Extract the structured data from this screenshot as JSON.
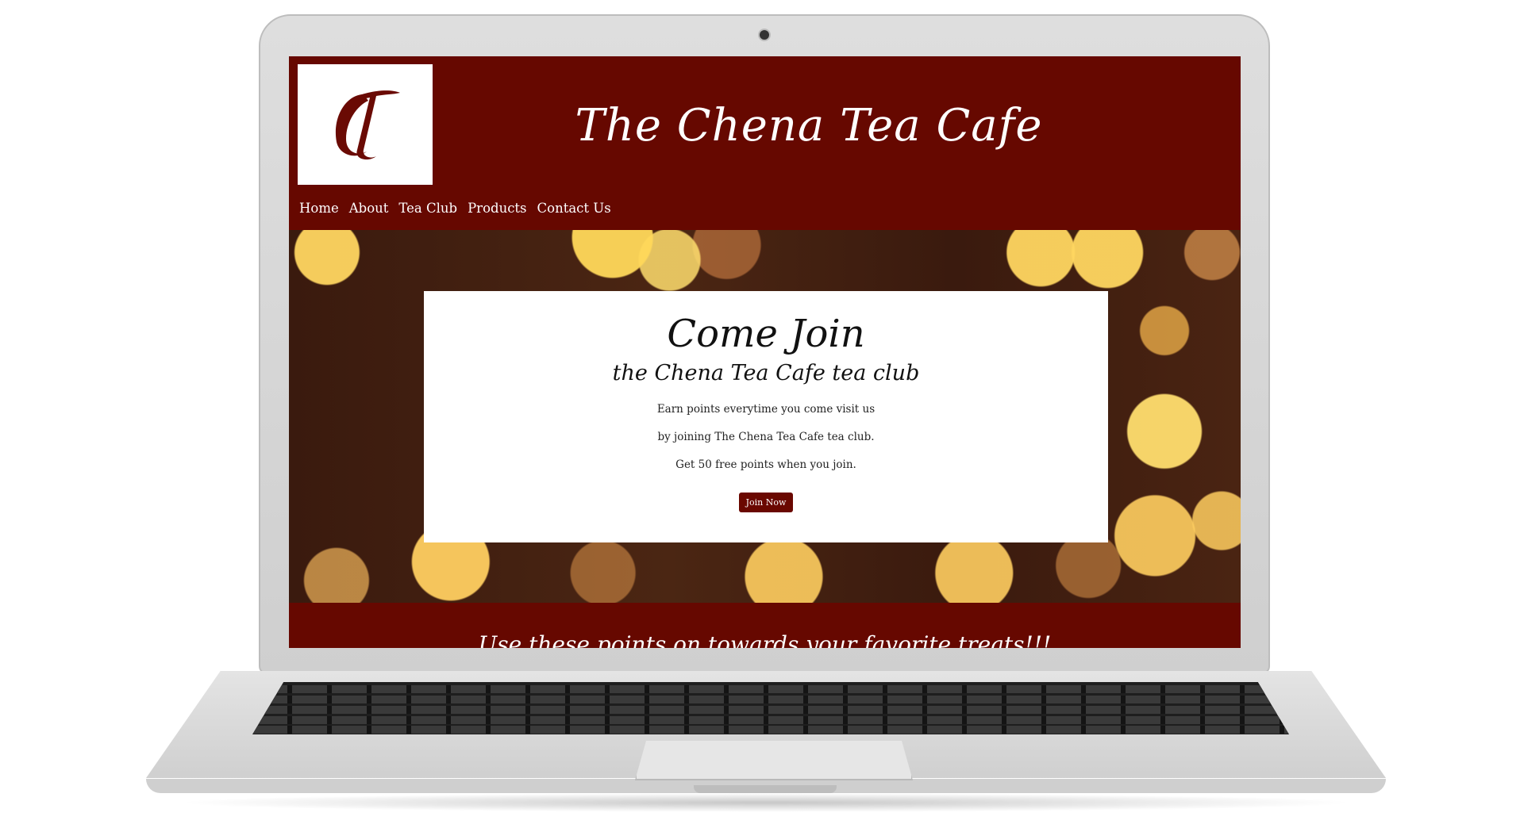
{
  "site": {
    "title": "The Chena Tea Cafe",
    "logo_icon": "tc-monogram-logo"
  },
  "nav": {
    "items": [
      {
        "label": "Home"
      },
      {
        "label": "About"
      },
      {
        "label": "Tea Club"
      },
      {
        "label": "Products"
      },
      {
        "label": "Contact Us"
      }
    ]
  },
  "hero": {
    "heading": "Come Join",
    "subheading": "the Chena Tea Cafe tea club",
    "lines": [
      "Earn points everytime you come visit us",
      "by joining The Chena Tea Cafe tea club.",
      "Get 50 free points when you join."
    ],
    "button_label": "Join Now"
  },
  "footer": {
    "text": "Use these points on towards your favorite treats!!!"
  },
  "colors": {
    "brand": "#660800",
    "button": "#6a0800",
    "card": "#ffffff"
  }
}
